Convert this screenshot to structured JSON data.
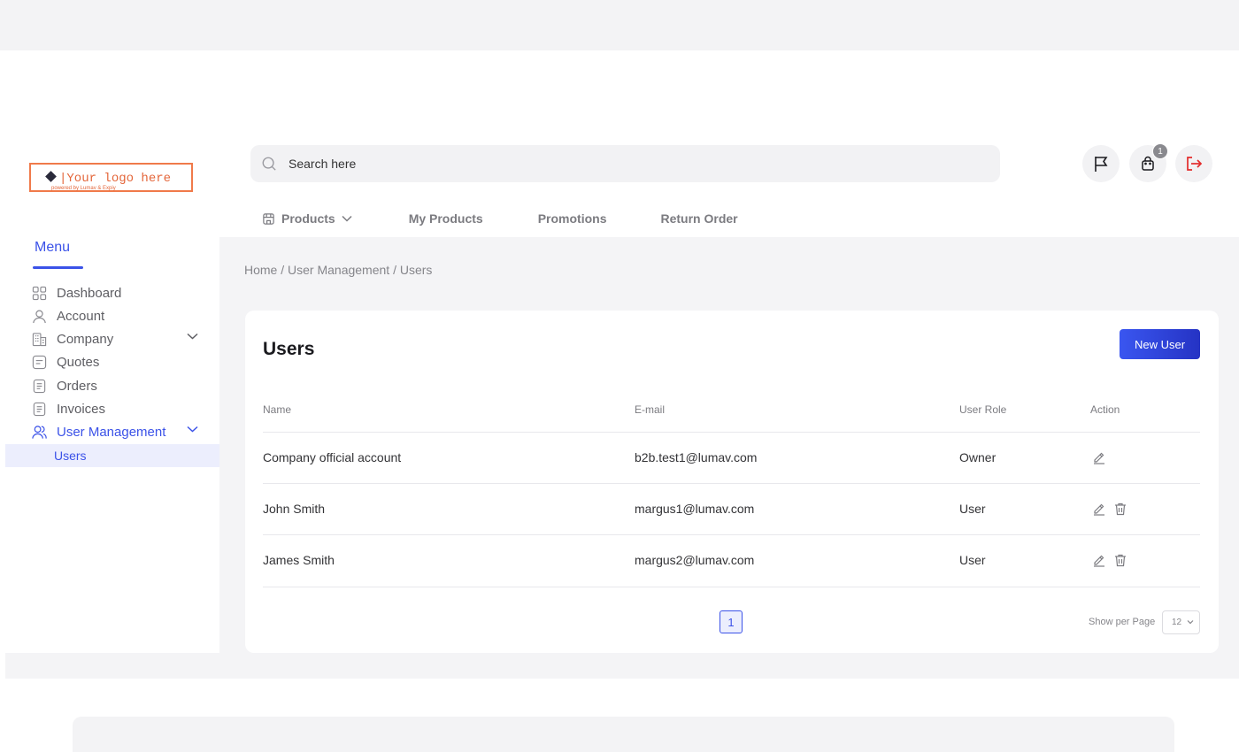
{
  "logo": {
    "text": "Your logo here",
    "sub": "powered by Lumav & Expiy"
  },
  "search": {
    "placeholder": "Search here"
  },
  "header": {
    "cart_count": "1",
    "icons": [
      "flag-icon",
      "shopping-bag-icon",
      "logout-icon"
    ],
    "logout_color": "#e32b2b"
  },
  "topnav": {
    "items": [
      "Products",
      "My Products",
      "Promotions",
      "Return Order"
    ]
  },
  "sidebar": {
    "menu_label": "Menu",
    "items": [
      {
        "label": "Dashboard",
        "icon": "grid-icon"
      },
      {
        "label": "Account",
        "icon": "user-icon"
      },
      {
        "label": "Company",
        "icon": "building-icon"
      },
      {
        "label": "Quotes",
        "icon": "quote-icon"
      },
      {
        "label": "Orders",
        "icon": "document-icon"
      },
      {
        "label": "Invoices",
        "icon": "invoice-icon"
      },
      {
        "label": "User Management",
        "icon": "users-icon"
      }
    ],
    "sub_active": "Users"
  },
  "breadcrumb": "Home / User Management / Users",
  "card": {
    "title": "Users",
    "new_user_label": "New User",
    "columns": [
      "Name",
      "E-mail",
      "User Role",
      "Action"
    ],
    "rows": [
      {
        "name": "Company official account",
        "email": "b2b.test1@lumav.com",
        "role": "Owner"
      },
      {
        "name": "John Smith",
        "email": "margus1@lumav.com",
        "role": "User"
      },
      {
        "name": "James Smith",
        "email": "margus2@lumav.com",
        "role": "User"
      }
    ],
    "page": "1",
    "per_page_label": "Show per Page",
    "per_page_value": "12"
  },
  "colors": {
    "accent": "#3b52e8",
    "logo": "#e4663a"
  }
}
